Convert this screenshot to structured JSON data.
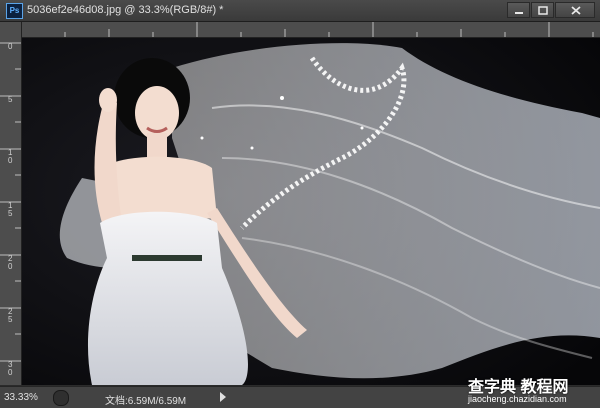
{
  "window": {
    "app_badge": "Ps",
    "title": "5036ef2e46d08.jpg @ 33.3%(RGB/8#) *"
  },
  "rulers": {
    "vertical_labels": [
      "0",
      "5",
      "1\n0",
      "1\n5",
      "2\n0",
      "2\n5",
      "3\n0"
    ]
  },
  "canvas": {
    "content": "bride-photo",
    "background_color": "#0e0e10"
  },
  "status": {
    "zoom": "33.33%",
    "doc_info": "文档:6.59M/6.59M"
  },
  "watermark": {
    "main": "查字典 教程网",
    "sub": "jiaocheng.chazidian.com"
  }
}
